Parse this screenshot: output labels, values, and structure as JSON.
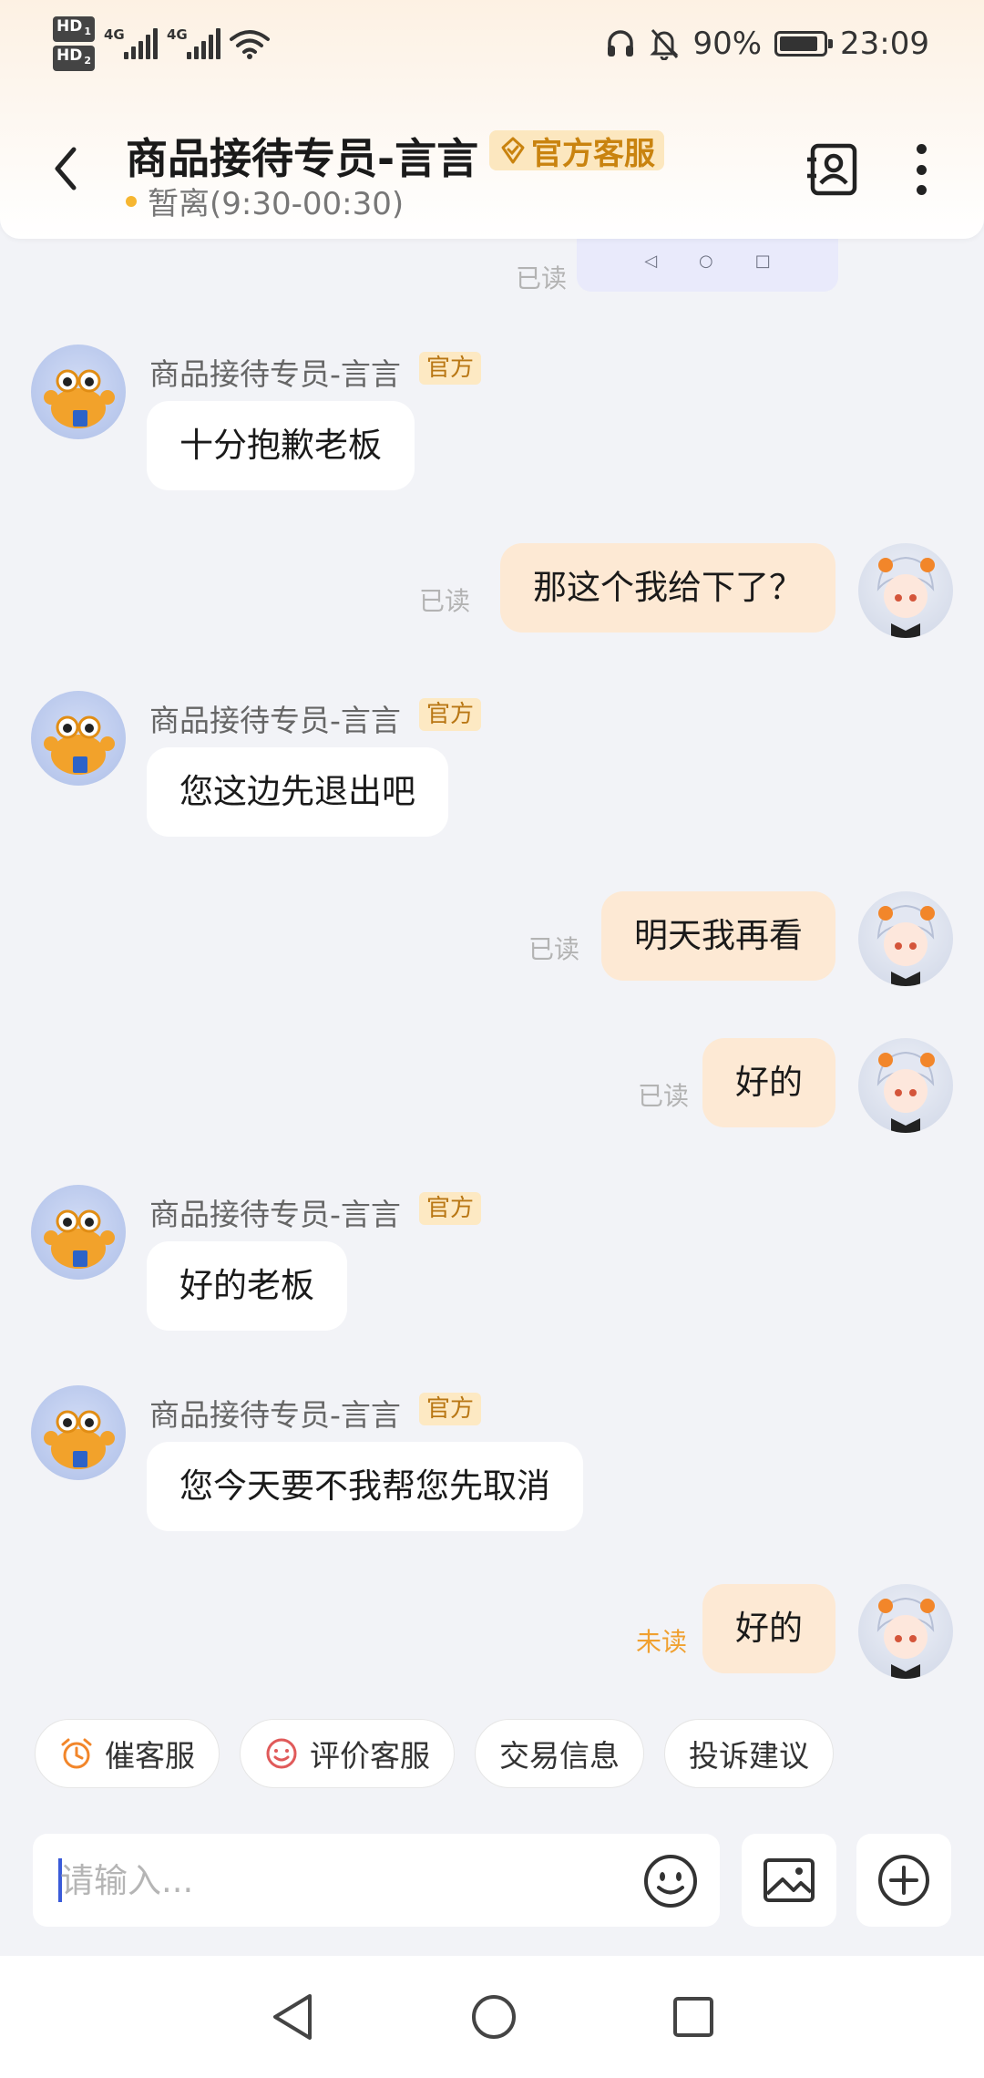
{
  "status_bar": {
    "hd1": "HD",
    "hd1_sub": "1",
    "hd2": "HD",
    "hd2_sub": "2",
    "net1": "4G",
    "net2": "4G",
    "battery_pct": "90%",
    "battery_level": 0.9,
    "time": "23:09"
  },
  "header": {
    "title": "商品接待专员-言言",
    "badge": "官方客服",
    "status": "暂离(9:30-00:30)",
    "icons": [
      "back-icon",
      "contact-card-icon",
      "more-icon"
    ]
  },
  "chat": {
    "top_read": "已读",
    "agent_name": "商品接待专员-言言",
    "official_tag": "官方",
    "messages": [
      {
        "side": "in",
        "text": "十分抱歉老板"
      },
      {
        "side": "out",
        "text": "那这个我给下了？",
        "read": "已读"
      },
      {
        "side": "in",
        "text": "您这边先退出吧"
      },
      {
        "side": "out",
        "text": "明天我再看",
        "read": "已读"
      },
      {
        "side": "out",
        "text": "好的",
        "read": "已读"
      },
      {
        "side": "in",
        "text": "好的老板"
      },
      {
        "side": "in",
        "text": "您今天要不我帮您先取消"
      },
      {
        "side": "out",
        "text": "好的",
        "read": "未读"
      }
    ]
  },
  "quick_actions": [
    {
      "label": "催客服",
      "icon": "alarm-clock-icon"
    },
    {
      "label": "评价客服",
      "icon": "smile-icon"
    },
    {
      "label": "交易信息",
      "icon": ""
    },
    {
      "label": "投诉建议",
      "icon": ""
    }
  ],
  "input": {
    "placeholder": "请输入..."
  },
  "colors": {
    "accent_orange": "#f0a030",
    "outgoing_bubble": "#fde9d4",
    "official_badge_bg": "#fce7bf",
    "official_badge_text": "#c9830f",
    "caret": "#3a5bd9"
  }
}
